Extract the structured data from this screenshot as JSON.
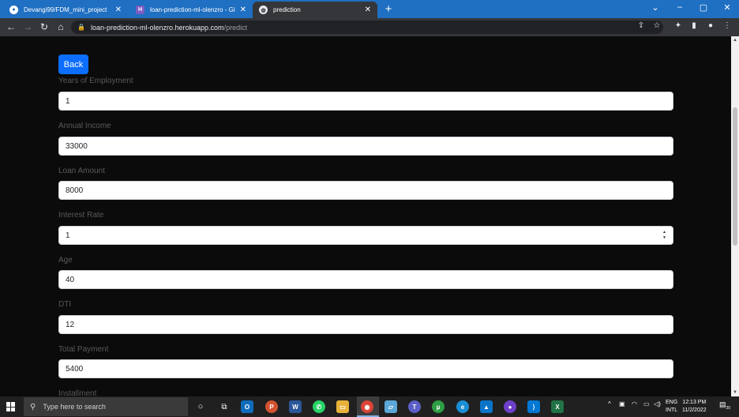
{
  "browser": {
    "tabs": [
      {
        "label": "Devangi99/FDM_mini_project",
        "icon": "github-icon",
        "active": false
      },
      {
        "label": "loan-prediction-ml-olenzro - GitHub",
        "icon": "heroku-icon",
        "active": false
      },
      {
        "label": "prediction",
        "icon": "globe-icon",
        "active": true
      }
    ],
    "address": {
      "host": "loan-prediction-ml-olenzro.herokuapp.com",
      "path": "/predict"
    }
  },
  "page": {
    "back_label": "Back",
    "fields": [
      {
        "label": "Years of Employment",
        "value": "1"
      },
      {
        "label": "Annual Income",
        "value": "33000"
      },
      {
        "label": "Loan Amount",
        "value": "8000"
      },
      {
        "label": "Interest Rate",
        "value": "1"
      },
      {
        "label": "Age",
        "value": "40"
      },
      {
        "label": "DTI",
        "value": "12"
      },
      {
        "label": "Total Payment",
        "value": "5400"
      },
      {
        "label": "Installment"
      }
    ]
  },
  "taskbar": {
    "search_placeholder": "Type here to search",
    "lang_top": "ENG",
    "lang_bottom": "INTL",
    "time": "12:13 PM",
    "date": "11/2/2022",
    "notification_count": "20"
  },
  "colors": {
    "primary_button": "#0d6efd",
    "tab_bar": "#1f6fc2"
  }
}
